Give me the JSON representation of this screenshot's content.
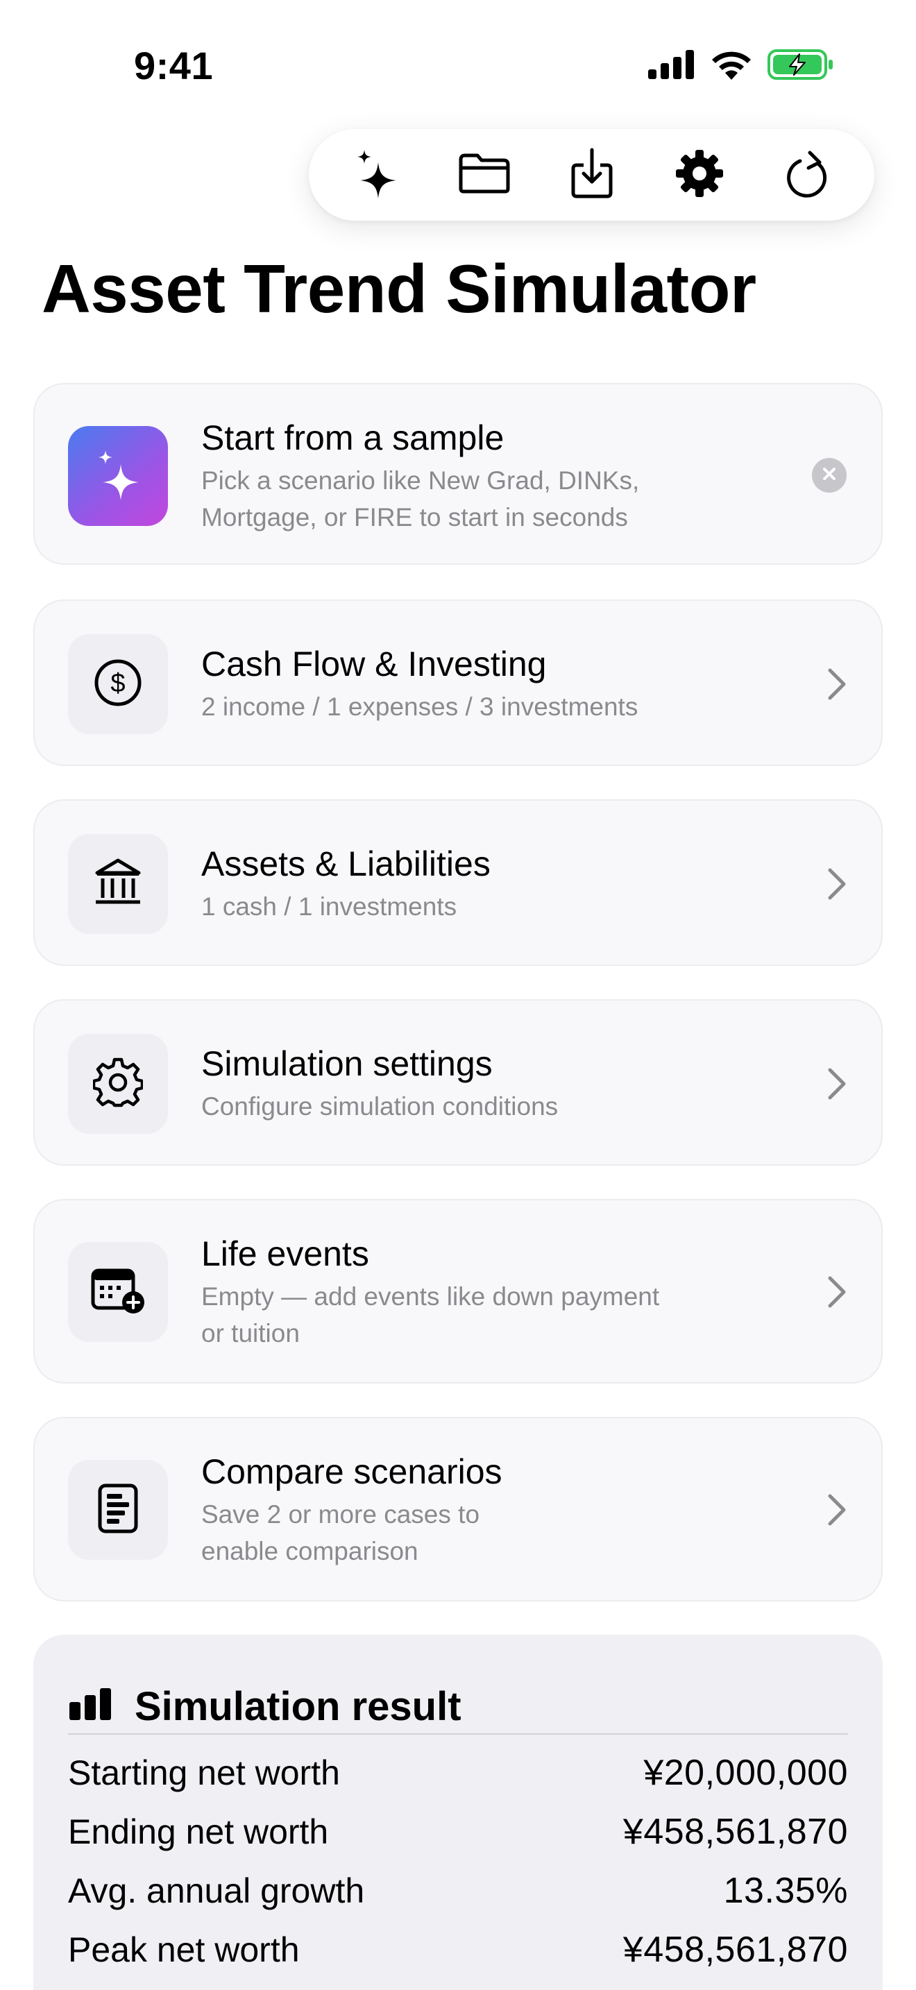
{
  "status_bar": {
    "time": "9:41",
    "icons": [
      "cellular-signal-icon",
      "wifi-icon",
      "battery-charging-icon"
    ]
  },
  "toolbar": {
    "buttons": [
      {
        "name": "sparkles-icon"
      },
      {
        "name": "folder-icon"
      },
      {
        "name": "download-icon"
      },
      {
        "name": "gear-icon"
      },
      {
        "name": "refresh-icon"
      }
    ]
  },
  "title": "Asset Trend Simulator",
  "cards": {
    "sample": {
      "title": "Start from a sample",
      "subtitle_line1": "Pick a scenario like New Grad, DINKs,",
      "subtitle_line2": "Mortgage, or FIRE to start in seconds",
      "icon": "sparkles-icon"
    },
    "cashflow": {
      "title": "Cash Flow & Investing",
      "subtitle": "2 income / 1 expenses / 3 investments",
      "icon": "dollar-circle-icon"
    },
    "assets": {
      "title": "Assets & Liabilities",
      "subtitle": "1 cash / 1 investments",
      "icon": "bank-icon"
    },
    "settings": {
      "title": "Simulation settings",
      "subtitle": "Configure simulation conditions",
      "icon": "gear-icon"
    },
    "events": {
      "title": "Life events",
      "subtitle_line1": "Empty — add events like down payment",
      "subtitle_line2": "or tuition",
      "icon": "calendar-add-icon"
    },
    "compare": {
      "title": "Compare scenarios",
      "subtitle_line1": "Save 2 or more cases to",
      "subtitle_line2": "enable comparison",
      "icon": "document-list-icon"
    }
  },
  "result": {
    "title": "Simulation result",
    "icon": "bar-chart-icon",
    "rows": [
      {
        "label": "Starting net worth",
        "value": "¥20,000,000"
      },
      {
        "label": "Ending net worth",
        "value": "¥458,561,870"
      },
      {
        "label": "Avg. annual growth",
        "value": "13.35%"
      },
      {
        "label": "Peak net worth",
        "value": "¥458,561,870"
      }
    ]
  },
  "colors": {
    "card_bg": "#f8f8fa",
    "result_bg": "#f0f0f4",
    "subtitle": "#8a8a8e",
    "sample_gradient_start": "#4a7bef",
    "sample_gradient_end": "#c247dc",
    "battery_green": "#34c759"
  }
}
